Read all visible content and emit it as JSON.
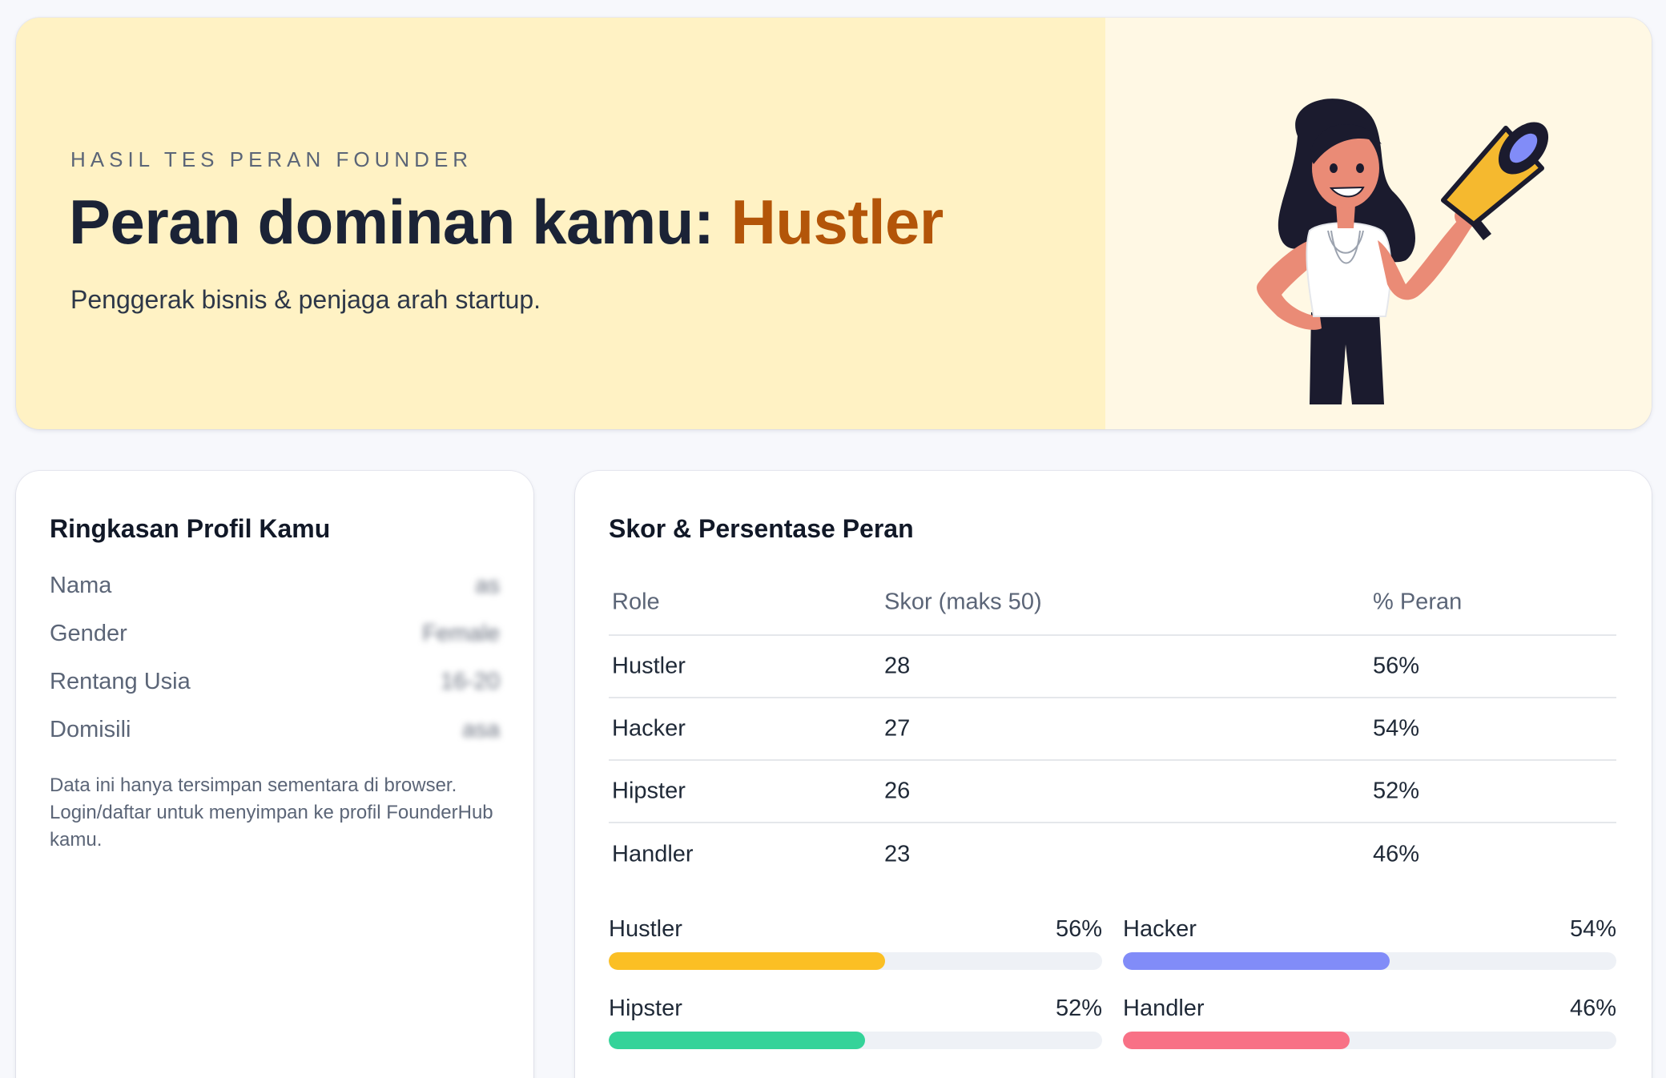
{
  "hero": {
    "eyebrow": "HASIL TES PERAN FOUNDER",
    "title_prefix": "Peran dominan kamu: ",
    "role": "Hustler",
    "subtitle": "Penggerak bisnis & penjaga arah startup.",
    "accent_color": "#b35509",
    "illustration_icon": "woman-with-megaphone-illustration"
  },
  "profile": {
    "title": "Ringkasan Profil Kamu",
    "rows": [
      {
        "label": "Nama",
        "value": "as"
      },
      {
        "label": "Gender",
        "value": "Female"
      },
      {
        "label": "Rentang Usia",
        "value": "16-20"
      },
      {
        "label": "Domisili",
        "value": "asa"
      }
    ],
    "note": "Data ini hanya tersimpan sementara di browser. Login/daftar untuk menyimpan ke profil FounderHub kamu."
  },
  "scores": {
    "title": "Skor & Persentase Peran",
    "columns": [
      "Role",
      "Skor (maks 50)",
      "% Peran"
    ],
    "rows": [
      {
        "role": "Hustler",
        "score": "28",
        "percent": "56%"
      },
      {
        "role": "Hacker",
        "score": "27",
        "percent": "54%"
      },
      {
        "role": "Hipster",
        "score": "26",
        "percent": "52%"
      },
      {
        "role": "Handler",
        "score": "23",
        "percent": "46%"
      }
    ],
    "bars": [
      {
        "label": "Hustler",
        "percent_label": "56%",
        "value": 56,
        "color": "#fbbf24"
      },
      {
        "label": "Hacker",
        "percent_label": "54%",
        "value": 54,
        "color": "#818cf8"
      },
      {
        "label": "Hipster",
        "percent_label": "52%",
        "value": 52,
        "color": "#34d399"
      },
      {
        "label": "Handler",
        "percent_label": "46%",
        "value": 46,
        "color": "#f87186"
      }
    ]
  }
}
